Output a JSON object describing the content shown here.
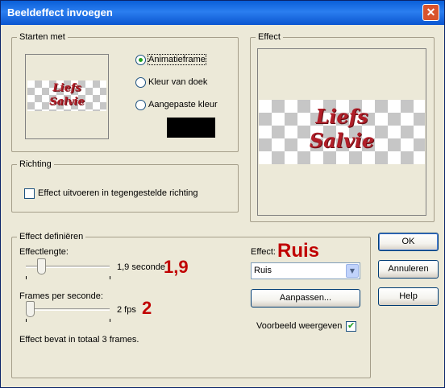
{
  "window": {
    "title": "Beeldeffect invoegen",
    "close_glyph": "✕"
  },
  "start_with": {
    "legend": "Starten met",
    "options": [
      {
        "label": "Animatieframe",
        "selected": true
      },
      {
        "label": "Kleur van doek",
        "selected": false
      },
      {
        "label": "Aangepaste kleur",
        "selected": false
      }
    ],
    "custom_color": "#000000",
    "preview_text_1": "Liefs",
    "preview_text_2": "Salvie"
  },
  "effect_preview": {
    "legend": "Effect",
    "text_1": "Liefs",
    "text_2": "Salvie"
  },
  "direction": {
    "legend": "Richting",
    "reverse_label": "Effect uitvoeren in tegengestelde richting",
    "reverse_checked": false
  },
  "define": {
    "legend": "Effect definiëren",
    "length_label": "Effectlengte:",
    "length_value": "1,9 seconde",
    "length_level": 0.19,
    "fps_label": "Frames per seconde:",
    "fps_value": "2 fps",
    "fps_level": 0.05,
    "summary": "Effect bevat in totaal 3 frames.",
    "effect_label": "Effect:",
    "effect_selected": "Ruis",
    "customize_label": "Aanpassen...",
    "preview_label": "Voorbeeld weergeven",
    "preview_checked": true
  },
  "annotations": {
    "effect": "Ruis",
    "length": "1,9",
    "fps": "2"
  },
  "buttons": {
    "ok": "OK",
    "cancel": "Annuleren",
    "help": "Help"
  },
  "colors": {
    "title_bar": "#0a5fd8",
    "annotation": "#c00000",
    "gothic_text": "#b01e28",
    "dialog_bg": "#ece9d8"
  }
}
